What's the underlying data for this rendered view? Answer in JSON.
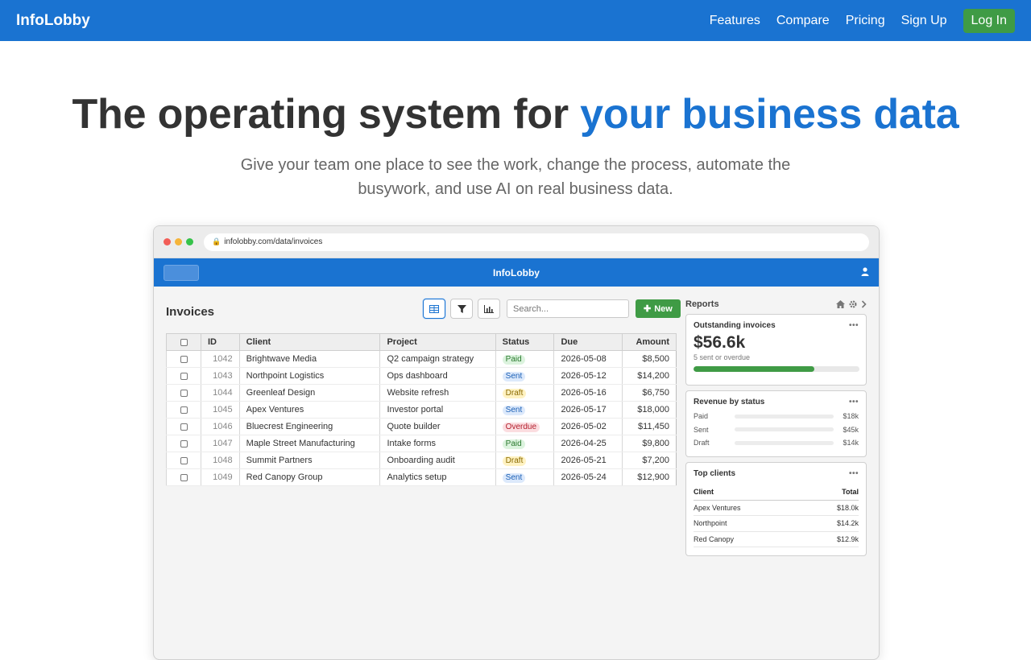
{
  "site": {
    "brand": "InfoLobby",
    "nav": [
      "Features",
      "Compare",
      "Pricing",
      "Sign Up"
    ],
    "login": "Log In"
  },
  "hero": {
    "title_plain": "The operating system for ",
    "title_accent": "your business data",
    "subtitle": "Give your team one place to see the work, change the process, automate the busywork, and use AI on real business data."
  },
  "browser": {
    "url": "infolobby.com/data/invoices"
  },
  "app": {
    "title": "InfoLobby",
    "page_title": "Invoices",
    "search_placeholder": "Search...",
    "new_label": "New",
    "columns": [
      "ID",
      "Client",
      "Project",
      "Status",
      "Due",
      "Amount"
    ],
    "rows": [
      {
        "id": "1042",
        "client": "Brightwave Media",
        "project": "Q2 campaign strategy",
        "status": "Paid",
        "due": "2026-05-08",
        "amount": "$8,500"
      },
      {
        "id": "1043",
        "client": "Northpoint Logistics",
        "project": "Ops dashboard",
        "status": "Sent",
        "due": "2026-05-12",
        "amount": "$14,200"
      },
      {
        "id": "1044",
        "client": "Greenleaf Design",
        "project": "Website refresh",
        "status": "Draft",
        "due": "2026-05-16",
        "amount": "$6,750"
      },
      {
        "id": "1045",
        "client": "Apex Ventures",
        "project": "Investor portal",
        "status": "Sent",
        "due": "2026-05-17",
        "amount": "$18,000"
      },
      {
        "id": "1046",
        "client": "Bluecrest Engineering",
        "project": "Quote builder",
        "status": "Overdue",
        "due": "2026-05-02",
        "amount": "$11,450"
      },
      {
        "id": "1047",
        "client": "Maple Street Manufacturing",
        "project": "Intake forms",
        "status": "Paid",
        "due": "2026-04-25",
        "amount": "$9,800"
      },
      {
        "id": "1048",
        "client": "Summit Partners",
        "project": "Onboarding audit",
        "status": "Draft",
        "due": "2026-05-21",
        "amount": "$7,200"
      },
      {
        "id": "1049",
        "client": "Red Canopy Group",
        "project": "Analytics setup",
        "status": "Sent",
        "due": "2026-05-24",
        "amount": "$12,900"
      }
    ]
  },
  "reports": {
    "title": "Reports",
    "outstanding": {
      "title": "Outstanding invoices",
      "value": "$56.6k",
      "note": "5 sent or overdue",
      "progress": 0.73
    },
    "revenue": {
      "title": "Revenue by status",
      "rows": [
        {
          "label": "Paid",
          "value": "$18k"
        },
        {
          "label": "Sent",
          "value": "$45k"
        },
        {
          "label": "Draft",
          "value": "$14k"
        }
      ]
    },
    "top_clients": {
      "title": "Top clients",
      "col_client": "Client",
      "col_total": "Total",
      "rows": [
        {
          "client": "Apex Ventures",
          "total": "$18.0k"
        },
        {
          "client": "Northpoint",
          "total": "$14.2k"
        },
        {
          "client": "Red Canopy",
          "total": "$12.9k"
        }
      ]
    }
  },
  "colors": {
    "brand_blue": "#1a73d1",
    "action_green": "#3f9b45"
  }
}
